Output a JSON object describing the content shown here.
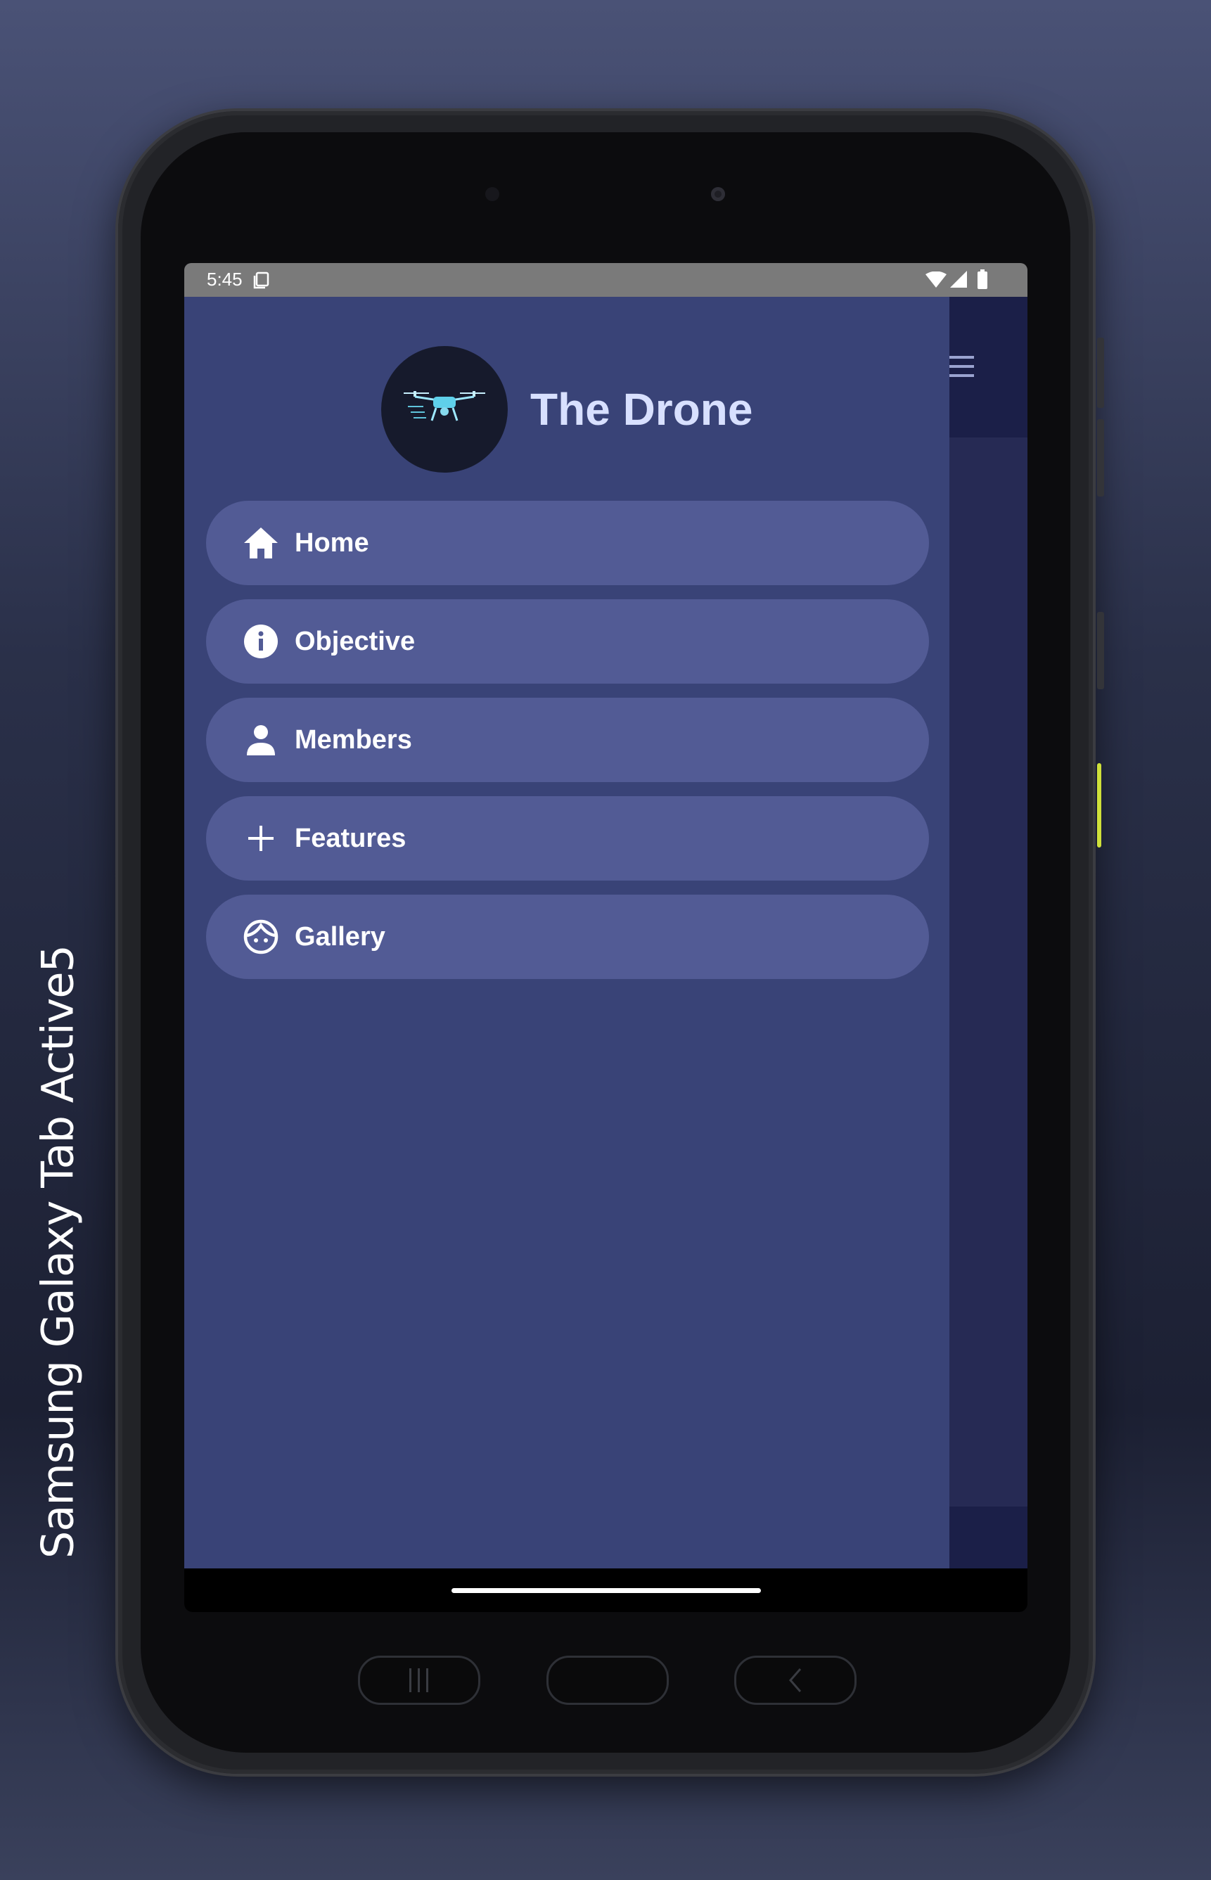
{
  "device_label": "Samsung Galaxy  Tab Active5",
  "status_bar": {
    "time": "5:45"
  },
  "drawer": {
    "brand_title": "The Drone",
    "items": [
      {
        "label": "Home",
        "icon": "home-icon"
      },
      {
        "label": "Objective",
        "icon": "info-icon"
      },
      {
        "label": "Members",
        "icon": "person-icon"
      },
      {
        "label": "Features",
        "icon": "plus-icon"
      },
      {
        "label": "Gallery",
        "icon": "face-icon"
      }
    ]
  },
  "colors": {
    "drawer_bg": "#394377",
    "nav_item_bg": "#525b95",
    "app_bar_bg": "#1b1f48",
    "brand_title": "#d8e0ff",
    "status_bar_bg": "#7a7a7a"
  }
}
